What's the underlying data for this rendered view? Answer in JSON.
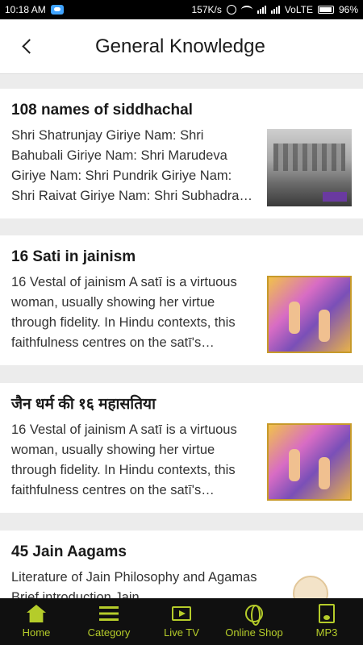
{
  "status_bar": {
    "time": "10:18 AM",
    "speed": "157K/s",
    "carrier": "VoLTE",
    "battery": "96%"
  },
  "header": {
    "title": "General Knowledge"
  },
  "cards": [
    {
      "title": "108 names of siddhachal",
      "text": "Shri Shatrunjay Giriye Nam: Shri Bahubali Giriye Nam: Shri Marudeva Giriye Nam: Shri Pundrik Giriye Nam: Shri Raivat Giriye Nam: Shri Subhadra…",
      "thumb": "mountain-temple-photo"
    },
    {
      "title": "16 Sati in jainism",
      "text": "16 Vestal of jainism A satī is a virtuous woman, usually showing her virtue through fidelity. In Hindu contexts, this faithfulness centres on the satī's…",
      "thumb": "sati-painting"
    },
    {
      "title": "जैन धर्म की १६ महासतिया",
      "text": "16 Vestal of jainism A satī is a virtuous woman, usually showing her virtue through fidelity. In Hindu contexts, this faithfulness centres on the satī's…",
      "thumb": "sati-painting"
    },
    {
      "title": "45 Jain Aagams",
      "text": "Literature of Jain Philosophy and Agamas Brief introduction Jain",
      "thumb": "aagam-illustration"
    }
  ],
  "bottom_nav": [
    {
      "label": "Home",
      "icon": "home-icon"
    },
    {
      "label": "Category",
      "icon": "list-icon"
    },
    {
      "label": "Live TV",
      "icon": "tv-icon"
    },
    {
      "label": "Online Shop",
      "icon": "globe-icon"
    },
    {
      "label": "MP3",
      "icon": "mp3-icon"
    }
  ],
  "colors": {
    "nav_accent": "#b5cc2a",
    "nav_background": "#101010"
  }
}
